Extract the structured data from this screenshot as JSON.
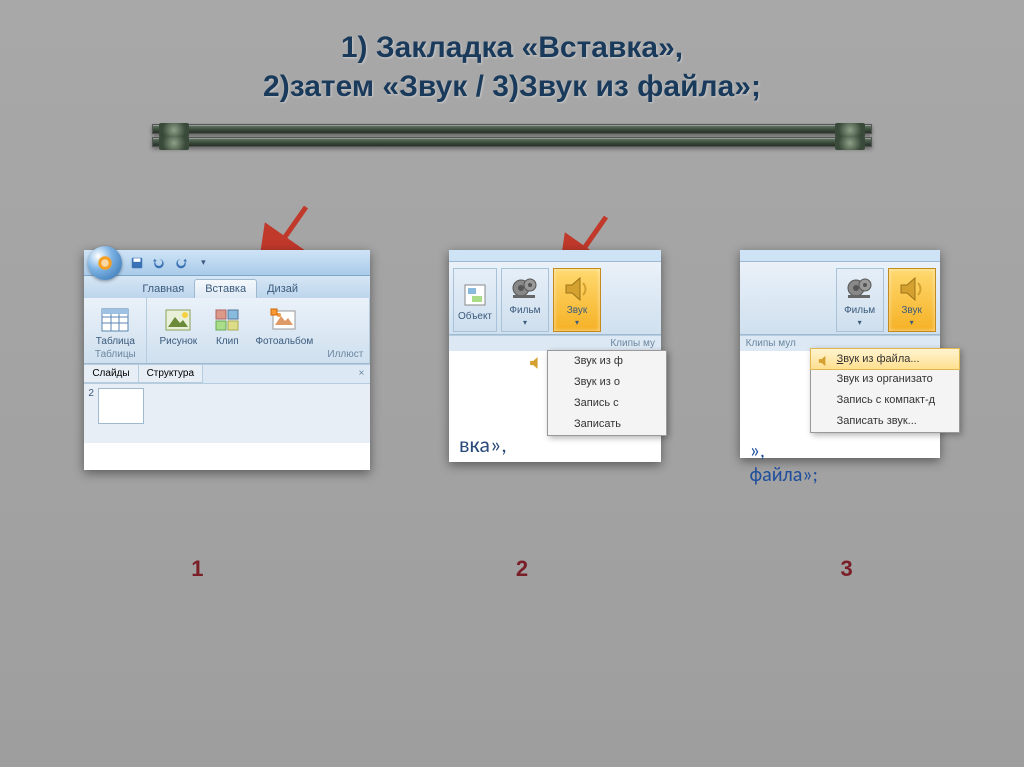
{
  "slide": {
    "title_line1": "1) Закладка «Вставка»,",
    "title_line2": "2)затем  «Звук / 3)Звук из файла»;",
    "step1": "1",
    "step2": "2",
    "step3": "3"
  },
  "panel1": {
    "tabs": {
      "home": "Главная",
      "insert": "Вставка",
      "design": "Дизай"
    },
    "groups": {
      "table": "Таблица",
      "picture": "Рисунок",
      "clip": "Клип",
      "photoalbum": "Фотоальбом"
    },
    "grouplabels": {
      "tables": "Таблицы",
      "illust": "Иллюст"
    },
    "navtabs": {
      "slides": "Слайды",
      "outline": "Структура"
    },
    "slidenum": "2"
  },
  "panel2": {
    "buttons": {
      "object": "Объект",
      "movie": "Фильм",
      "sound": "Звук"
    },
    "grouplabel": "Клипы му",
    "menu": {
      "fromfile": "Звук из ф",
      "fromorg": "Звук из о",
      "recordcd": "Запись с",
      "record": "Записать"
    },
    "content": "вка»,"
  },
  "panel3": {
    "buttons": {
      "movie": "Фильм",
      "sound": "Звук"
    },
    "grouplabel": "Клипы мул",
    "menu": {
      "fromfile": "Звук из файла...",
      "fromorg": "Звук из организато",
      "recordcd": "Запись с компакт-д",
      "record": "Записать звук..."
    },
    "content1": "»,",
    "content2": "файла»;"
  }
}
